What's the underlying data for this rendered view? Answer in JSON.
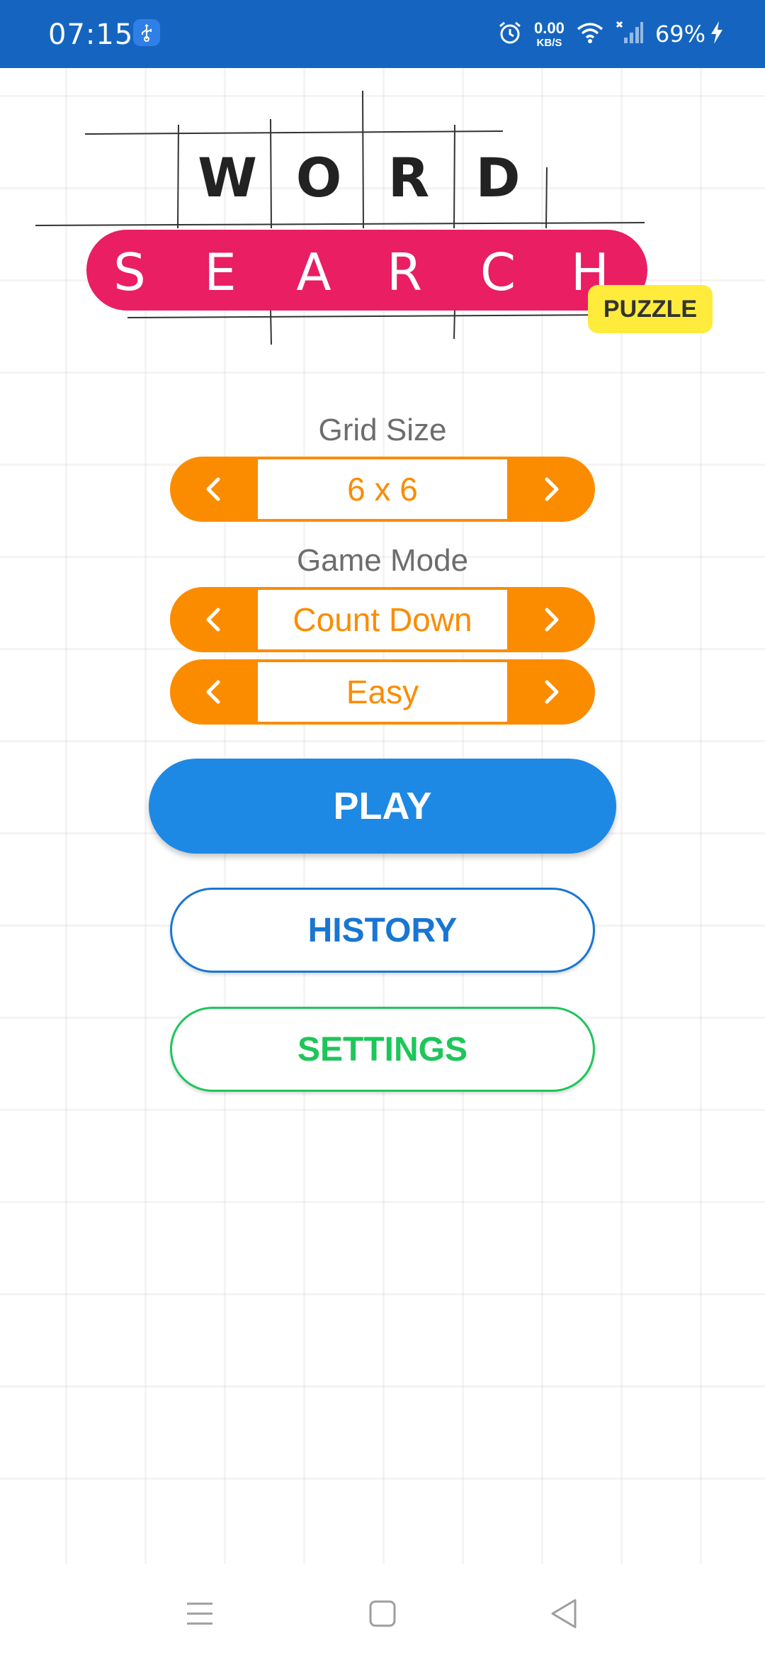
{
  "status_bar": {
    "time": "07:15",
    "net_speed_value": "0.00",
    "net_speed_unit": "KB/S",
    "battery": "69%",
    "icons": [
      "usb-icon",
      "alarm-icon",
      "wifi-icon",
      "no-signal-icon",
      "charging-icon"
    ]
  },
  "logo": {
    "word": [
      "W",
      "O",
      "R",
      "D"
    ],
    "search": [
      "S",
      "E",
      "A",
      "R",
      "C",
      "H"
    ],
    "tag": "PUZZLE"
  },
  "grid_size": {
    "label": "Grid Size",
    "value": "6 x 6"
  },
  "game_mode": {
    "label": "Game Mode",
    "mode": "Count Down",
    "difficulty": "Easy"
  },
  "buttons": {
    "play": "PLAY",
    "history": "HISTORY",
    "settings": "SETTINGS"
  },
  "colors": {
    "status_bar": "#1565c0",
    "search_band": "#e91e63",
    "puzzle_tag": "#ffeb3b",
    "selector": "#fb8c00",
    "play": "#1e88e5",
    "history": "#1976d2",
    "settings": "#1ec65a"
  },
  "nav": {
    "icons": [
      "menu-icon",
      "home-square-icon",
      "back-triangle-icon"
    ]
  }
}
